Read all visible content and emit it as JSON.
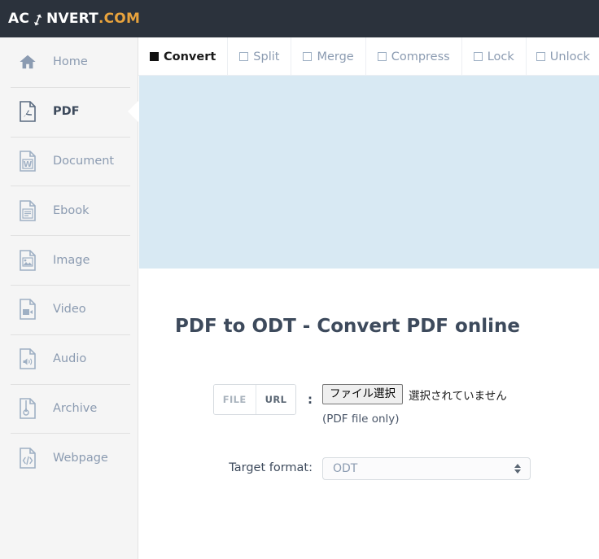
{
  "header": {
    "logo_part1": "AC",
    "logo_icon": "refresh-cycle-icon",
    "logo_part2": "NVERT",
    "logo_part3": ".COM",
    "background_color": "#2b323c",
    "accent_color": "#e8a33d"
  },
  "sidebar": {
    "items": [
      {
        "label": "Home",
        "icon": "home-icon",
        "active": false
      },
      {
        "label": "PDF",
        "icon": "pdf-file-icon",
        "active": true
      },
      {
        "label": "Document",
        "icon": "word-doc-icon",
        "active": false
      },
      {
        "label": "Ebook",
        "icon": "ebook-icon",
        "active": false
      },
      {
        "label": "Image",
        "icon": "image-file-icon",
        "active": false
      },
      {
        "label": "Video",
        "icon": "video-file-icon",
        "active": false
      },
      {
        "label": "Audio",
        "icon": "audio-file-icon",
        "active": false
      },
      {
        "label": "Archive",
        "icon": "archive-file-icon",
        "active": false
      },
      {
        "label": "Webpage",
        "icon": "webpage-code-icon",
        "active": false
      }
    ]
  },
  "tabs": [
    {
      "label": "Convert",
      "icon": "filled-square-icon",
      "active": true
    },
    {
      "label": "Split",
      "icon": "empty-square-icon",
      "active": false
    },
    {
      "label": "Merge",
      "icon": "empty-square-icon",
      "active": false
    },
    {
      "label": "Compress",
      "icon": "empty-square-icon",
      "active": false
    },
    {
      "label": "Lock",
      "icon": "empty-square-icon",
      "active": false
    },
    {
      "label": "Unlock",
      "icon": "empty-square-icon",
      "active": false
    }
  ],
  "banner": {
    "background_color": "#d8e9f3"
  },
  "main": {
    "title": "PDF to ODT - Convert PDF online",
    "source_row": {
      "tab_file": "FILE",
      "tab_url": "URL",
      "colon": ":",
      "file_button_label": "ファイル選択",
      "file_status_text": "選択されていません",
      "note": "(PDF file only)"
    },
    "format_row": {
      "label": "Target format:",
      "selected_value": "ODT"
    }
  }
}
